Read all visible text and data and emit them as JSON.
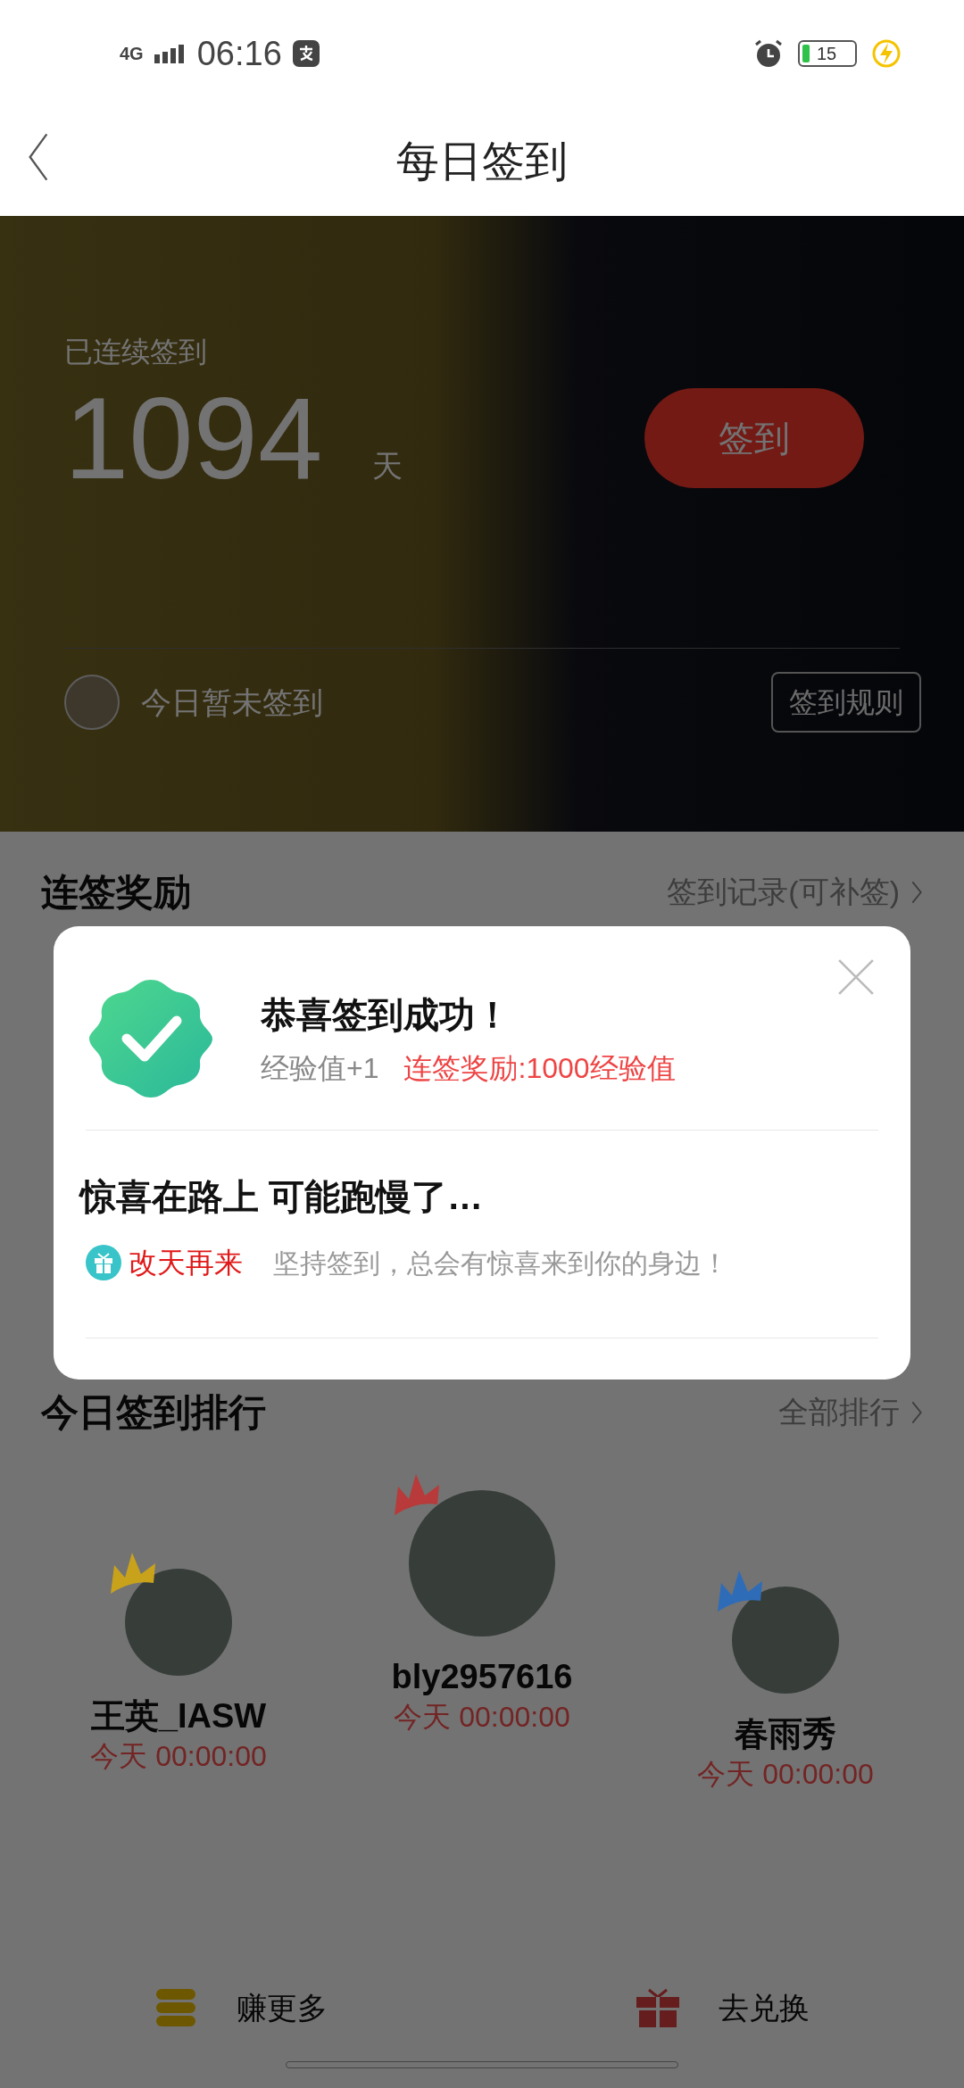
{
  "status_bar": {
    "network": "4G",
    "time": "06:16",
    "battery": "15"
  },
  "header": {
    "title": "每日签到"
  },
  "hero": {
    "streak_label": "已连续签到",
    "streak_days": "1094",
    "unit": "天",
    "sign_button": "签到",
    "today_status": "今日暂未签到",
    "rules_button": "签到规则"
  },
  "rewards_section": {
    "title": "连签奖励",
    "link": "签到记录(可补签)"
  },
  "ranking": {
    "title": "今日签到排行",
    "link": "全部排行",
    "entries": [
      {
        "name": "王英_IASW",
        "time": "今天 00:00:00",
        "color": "#c9a21c"
      },
      {
        "name": "bly2957616",
        "time": "今天 00:00:00",
        "color": "#b83a3a"
      },
      {
        "name": "春雨秀",
        "time": "今天 00:00:00",
        "color": "#2f6cb8"
      }
    ]
  },
  "bottom_bar": [
    {
      "label": "赚更多",
      "kind": "coins"
    },
    {
      "label": "去兑换",
      "kind": "gift"
    }
  ],
  "dialog": {
    "title": "恭喜签到成功！",
    "exp": "经验值+1",
    "bonus": "连签奖励:1000经验值",
    "subtitle": "惊喜在路上 可能跑慢了…",
    "tag": "改天再来",
    "message": "坚持签到，总会有惊喜来到你的身边！"
  }
}
